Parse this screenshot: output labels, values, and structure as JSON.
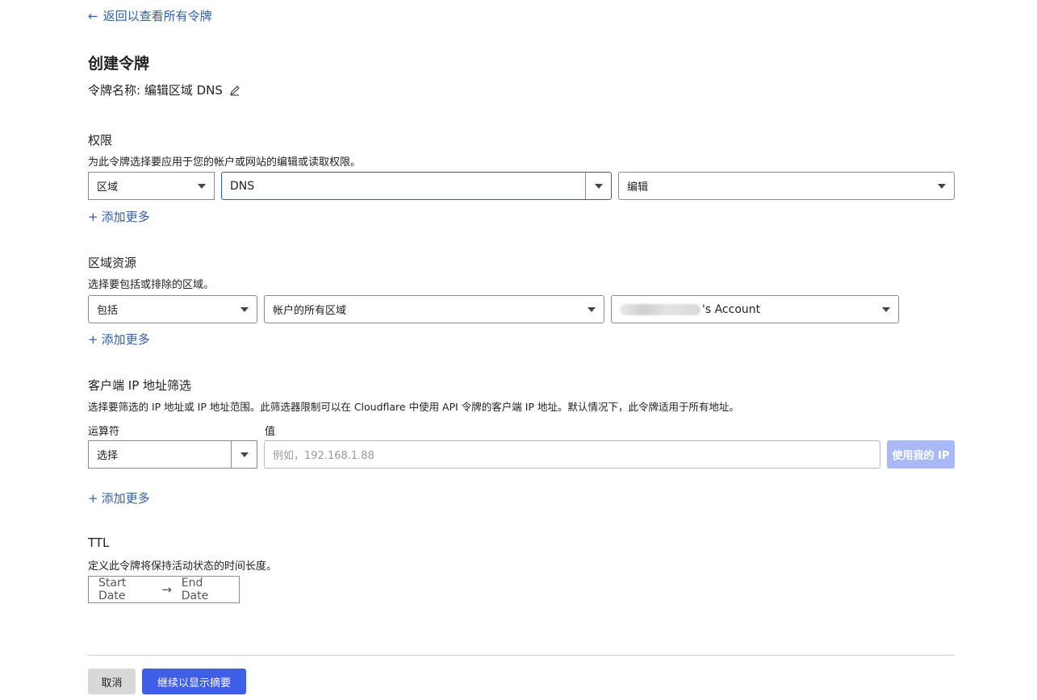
{
  "nav": {
    "back_label": "返回以查看所有令牌"
  },
  "page": {
    "title": "创建令牌",
    "token_name": "令牌名称: 编辑区域 DNS"
  },
  "permissions": {
    "title": "权限",
    "description": "为此令牌选择要应用于您的帐户或网站的编辑或读取权限。",
    "scope": "区域",
    "resource": "DNS",
    "access": "编辑",
    "add_more": "添加更多"
  },
  "zone_resources": {
    "title": "区域资源",
    "description": "选择要包括或排除的区域。",
    "include": "包括",
    "selection": "帐户的所有区域",
    "account_suffix": "'s Account",
    "add_more": "添加更多"
  },
  "ip_filtering": {
    "title": "客户端 IP 地址筛选",
    "description": "选择要筛选的 IP 地址或 IP 地址范围。此筛选器限制可以在 Cloudflare 中使用 API 令牌的客户端 IP 地址。默认情况下，此令牌适用于所有地址。",
    "operator_label": "运算符",
    "operator_value": "选择",
    "value_label": "值",
    "value_placeholder": "例如，192.168.1.88",
    "use_my_ip": "使用我的 IP",
    "add_more": "添加更多"
  },
  "ttl": {
    "title": "TTL",
    "description": "定义此令牌将保持活动状态的时间长度。",
    "start_placeholder": "Start Date",
    "end_placeholder": "End Date"
  },
  "footer": {
    "cancel": "取消",
    "continue": "继续以显示摘要"
  },
  "colors": {
    "link": "#2f5ea8",
    "primary_button": "#3f5ee8",
    "disabled_button": "#a9b9f5"
  }
}
